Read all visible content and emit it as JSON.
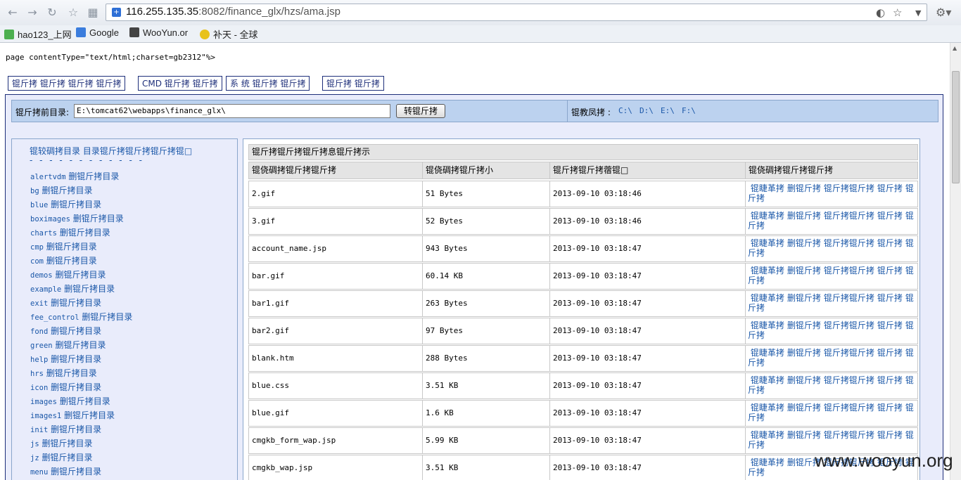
{
  "browser": {
    "url_host": "116.255.135.35",
    "url_rest": ":8082/finance_glx/hzs/ama.jsp",
    "bookmarks": [
      "hao123_上网",
      "Google",
      "WooYun.or",
      "补天 - 全球"
    ]
  },
  "page": {
    "directive": "page contentType=\"text/html;charset=gb2312\"%>",
    "top_buttons": [
      "锟斤拷 锟斤拷 锟斤拷 锟斤拷",
      "CMD 锟斤拷 锟斤拷",
      "系 统 锟斤拷 锟斤拷",
      "锟斤拷 锟斤拷"
    ],
    "path_label": "锟斤拷前目录:",
    "path_value": "E:\\tomcat62\\webapps\\finance_glx\\",
    "go_button": "转锟斤拷",
    "drives_label": "锟教凤拷 :",
    "drives": [
      "C:\\",
      "D:\\",
      "E:\\",
      "F:\\"
    ],
    "left_header": "锟较碉拷目录 目录锟斤拷锟斤拷锟斤拷锟□",
    "left_dashes": "- - - - - - - - - - - -",
    "dirs": [
      {
        "name": "alertvdm",
        "action": "删锟斤拷目录"
      },
      {
        "name": "bg",
        "action": "删锟斤拷目录"
      },
      {
        "name": "blue",
        "action": "删锟斤拷目录"
      },
      {
        "name": "boximages",
        "action": "删锟斤拷目录"
      },
      {
        "name": "charts",
        "action": "删锟斤拷目录"
      },
      {
        "name": "cmp",
        "action": "删锟斤拷目录"
      },
      {
        "name": "com",
        "action": "删锟斤拷目录"
      },
      {
        "name": "demos",
        "action": "删锟斤拷目录"
      },
      {
        "name": "example",
        "action": "删锟斤拷目录"
      },
      {
        "name": "exit",
        "action": "删锟斤拷目录"
      },
      {
        "name": "fee_control",
        "action": "删锟斤拷目录"
      },
      {
        "name": "fond",
        "action": "删锟斤拷目录"
      },
      {
        "name": "green",
        "action": "删锟斤拷目录"
      },
      {
        "name": "help",
        "action": "删锟斤拷目录"
      },
      {
        "name": "hrs",
        "action": "删锟斤拷目录"
      },
      {
        "name": "icon",
        "action": "删锟斤拷目录"
      },
      {
        "name": "images",
        "action": "删锟斤拷目录"
      },
      {
        "name": "images1",
        "action": "删锟斤拷目录"
      },
      {
        "name": "init",
        "action": "删锟斤拷目录"
      },
      {
        "name": "js",
        "action": "删锟斤拷目录"
      },
      {
        "name": "jz",
        "action": "删锟斤拷目录"
      },
      {
        "name": "menu",
        "action": "删锟斤拷目录"
      }
    ],
    "file_list_title": "锟斤拷锟斤拷锟斤拷息锟斤拷示",
    "columns": [
      "锟侥碉拷锟斤拷锟斤拷",
      "锟侥碉拷锟斤拷小",
      "锟斤拷锟斤拷蓿锟□",
      "锟侥碉拷锟斤拷锟斤拷"
    ],
    "actions": [
      "锟睫革拷",
      "删锟斤拷",
      "锟斤拷锟斤拷",
      "锟斤拷",
      "锟斤拷"
    ],
    "files": [
      {
        "name": "2.gif",
        "size": "51 Bytes",
        "date": "2013-09-10 03:18:46"
      },
      {
        "name": "3.gif",
        "size": "52 Bytes",
        "date": "2013-09-10 03:18:46"
      },
      {
        "name": "account_name.jsp",
        "size": "943 Bytes",
        "date": "2013-09-10 03:18:47"
      },
      {
        "name": "bar.gif",
        "size": "60.14 KB",
        "date": "2013-09-10 03:18:47"
      },
      {
        "name": "bar1.gif",
        "size": "263 Bytes",
        "date": "2013-09-10 03:18:47"
      },
      {
        "name": "bar2.gif",
        "size": "97 Bytes",
        "date": "2013-09-10 03:18:47"
      },
      {
        "name": "blank.htm",
        "size": "288 Bytes",
        "date": "2013-09-10 03:18:47"
      },
      {
        "name": "blue.css",
        "size": "3.51 KB",
        "date": "2013-09-10 03:18:47"
      },
      {
        "name": "blue.gif",
        "size": "1.6 KB",
        "date": "2013-09-10 03:18:47"
      },
      {
        "name": "cmgkb_form_wap.jsp",
        "size": "5.99 KB",
        "date": "2013-09-10 03:18:47"
      },
      {
        "name": "cmgkb_wap.jsp",
        "size": "3.51 KB",
        "date": "2013-09-10 03:18:47"
      }
    ]
  },
  "watermark": "www.wooyun.org"
}
